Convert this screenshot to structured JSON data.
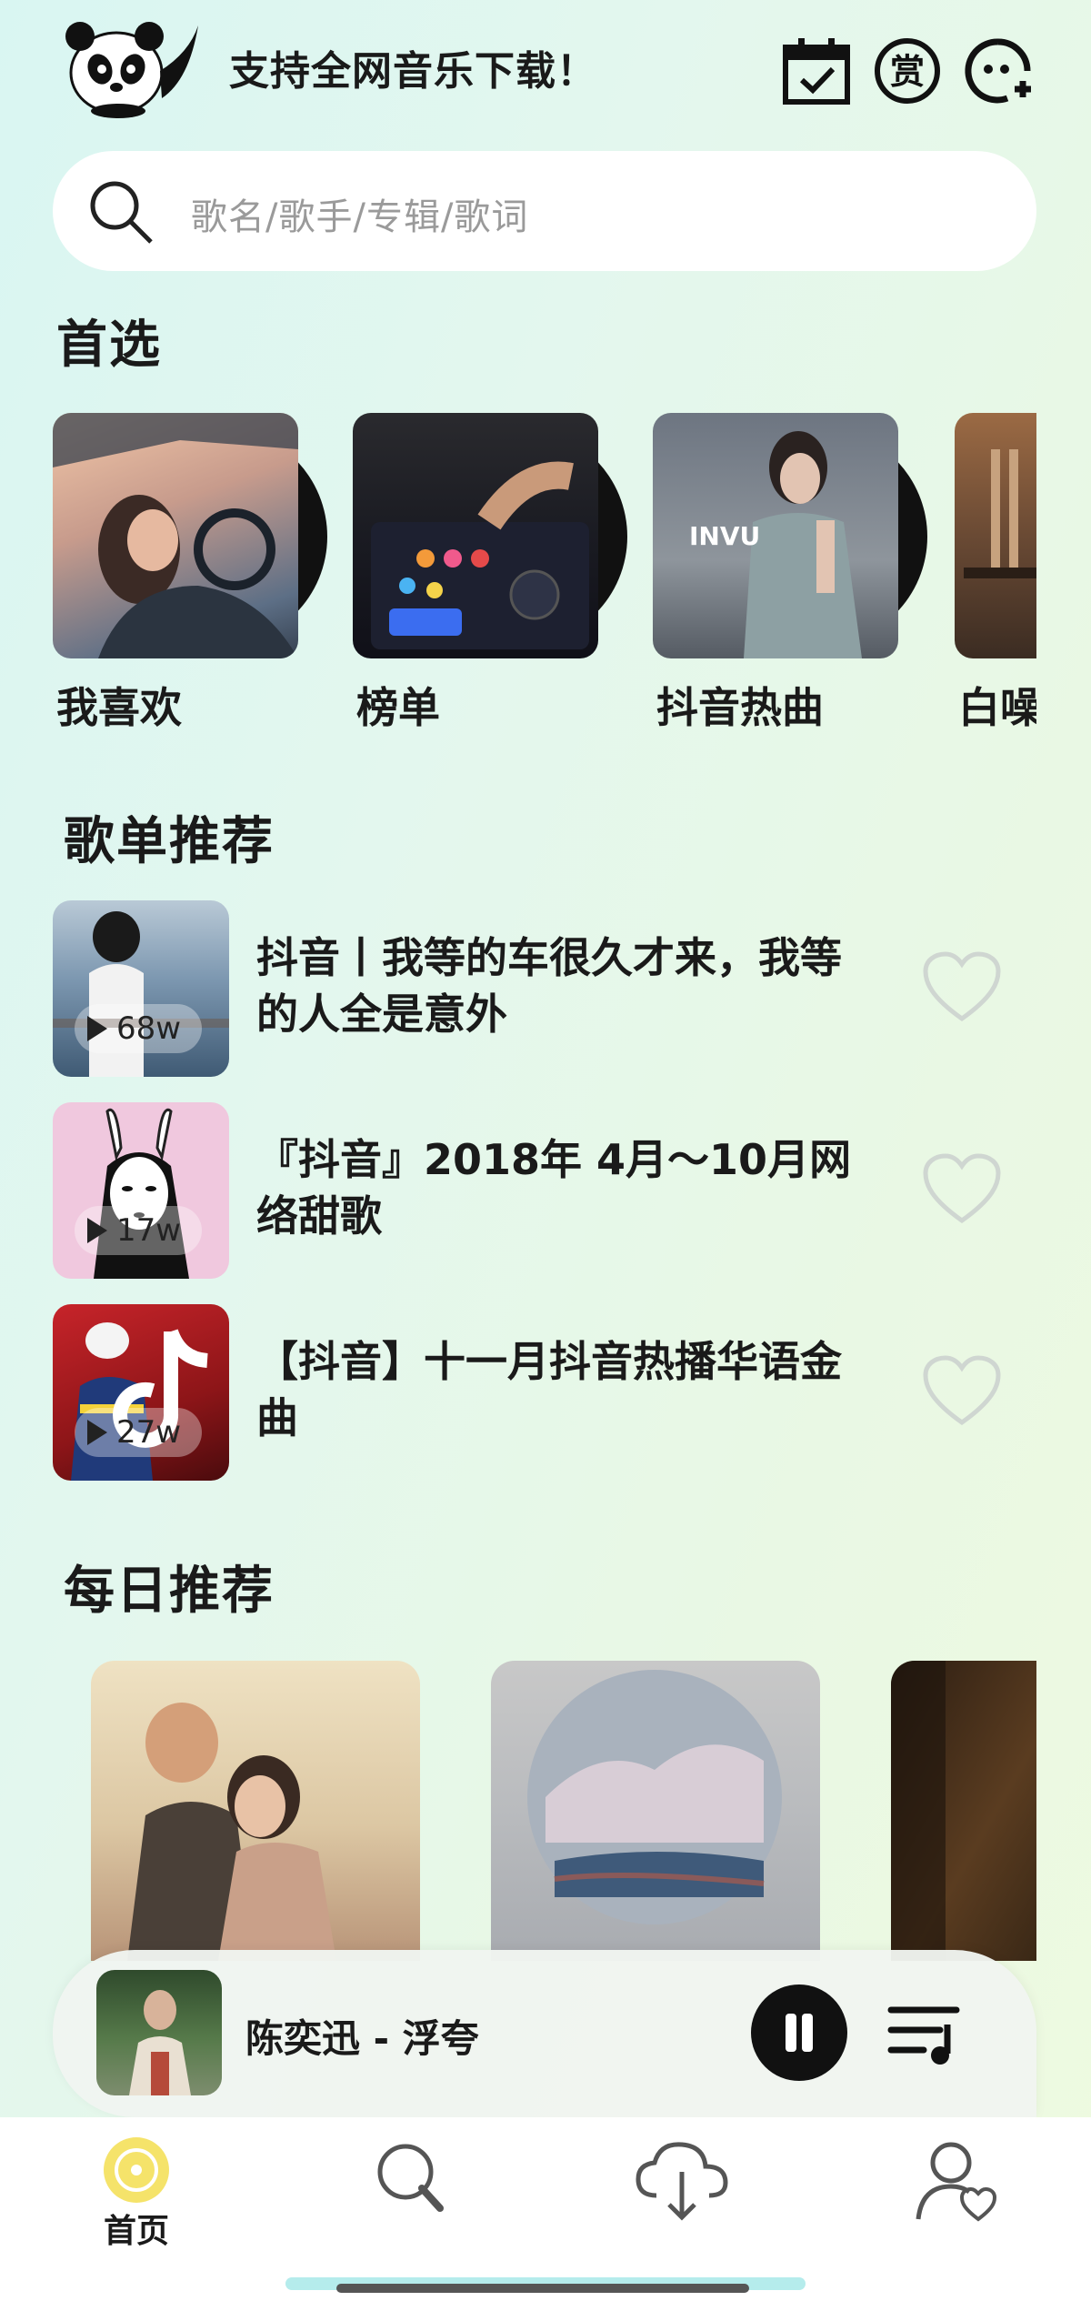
{
  "header": {
    "app_title": "支持全网音乐下载！"
  },
  "search": {
    "placeholder": "歌名/歌手/专辑/歌词"
  },
  "featured": {
    "title": "首选",
    "items": [
      {
        "label": "我喜欢"
      },
      {
        "label": "榜单"
      },
      {
        "label": "抖音热曲"
      },
      {
        "label": "白噪"
      }
    ]
  },
  "playlists": {
    "title": "歌单推荐",
    "items": [
      {
        "title": "抖音丨我等的车很久才来，我等的人全是意外",
        "plays": "68w"
      },
      {
        "title": "『抖音』2018年 4月～10月网络甜歌",
        "plays": "17w"
      },
      {
        "title": "【抖音】十一月抖音热播华语金曲",
        "plays": "27w"
      }
    ]
  },
  "daily": {
    "title": "每日推荐"
  },
  "player": {
    "now_playing": "陈奕迅 - 浮夸"
  },
  "nav": {
    "items": [
      {
        "label": "首页",
        "icon": "home-disc-icon",
        "active": true
      },
      {
        "label": "",
        "icon": "search-icon"
      },
      {
        "label": "",
        "icon": "cloud-download-icon"
      },
      {
        "label": "",
        "icon": "profile-heart-icon"
      }
    ]
  },
  "colors": {
    "accent_yellow": "#f5e36a",
    "background_start": "#d9f6f2",
    "background_end": "#eefae0",
    "heart_outline": "#c9d0cc"
  }
}
